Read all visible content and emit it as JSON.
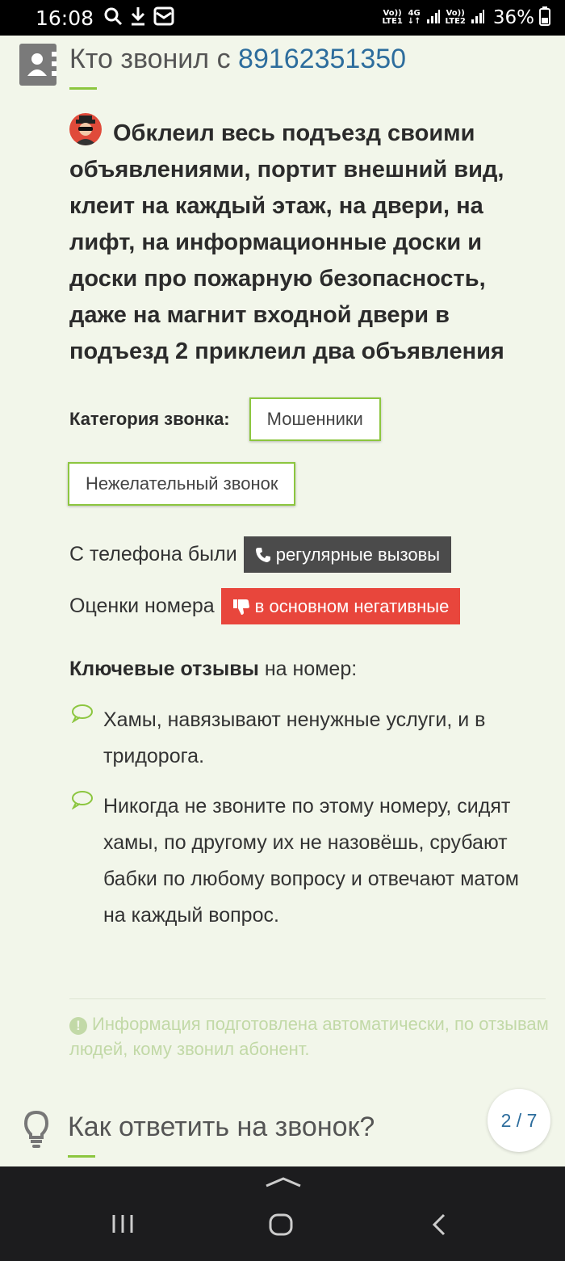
{
  "status_bar": {
    "time": "16:08",
    "sim1_top": "Vo))",
    "sim1_bottom": "LTE1",
    "net_top": "4G",
    "sim2_top": "Vo))",
    "sim2_bottom": "LTE2",
    "battery": "36%",
    "icons": [
      "search-icon",
      "download-icon",
      "mail-icon",
      "signal-icon",
      "battery-icon"
    ]
  },
  "header": {
    "title_prefix": "Кто звонил с",
    "phone": "89162351350",
    "icon": "contact-book-icon"
  },
  "comment": {
    "avatar_icon": "spy-avatar-icon",
    "text": "Обклеил весь подъезд своими объявлениями, портит внешний вид, клеит на каждый этаж, на двери, на лифт, на информационные доски и доски про пожарную безопасность, даже на магнит входной двери в подъезд 2 приклеил два объявления"
  },
  "category": {
    "label": "Категория звонка:",
    "tags": [
      "Мошенники",
      "Нежелательный звонок"
    ]
  },
  "calls_info": {
    "label": "С телефона были",
    "badge": "регулярные вызовы",
    "badge_icon": "phone-icon"
  },
  "rating_info": {
    "label": "Оценки номера",
    "badge": "в основном негативные",
    "badge_icon": "thumbs-down-icon"
  },
  "key_reviews": {
    "title_bold": "Ключевые отзывы",
    "title_rest": " на номер:",
    "items": [
      "Хамы, навязывают ненужные услуги, и в тридорога.",
      "Никогда не звоните по этому номеру, сидят хамы, по другому их не назовёшь, срубают бабки по любому вопросу и отвечают матом на каждый вопрос."
    ]
  },
  "auto_note": "Информация подготовлена автоматически, по отзывам людей, кому звонил абонент.",
  "next_section": {
    "title": "Как ответить на звонок?",
    "icon": "lightbulb-icon"
  },
  "pager": {
    "current": "2",
    "separator": " / ",
    "total": "7"
  },
  "colors": {
    "background": "#f2f6ea",
    "accent_green": "#8cc63f",
    "link_blue": "#2d6d9d",
    "badge_dark": "#4b4b4b",
    "badge_red": "#e8463c"
  }
}
